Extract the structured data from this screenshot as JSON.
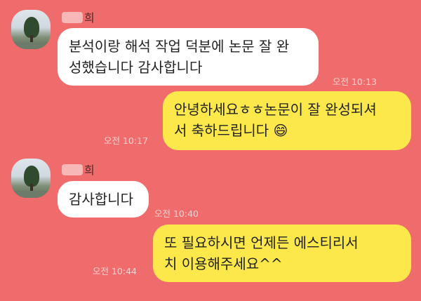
{
  "messages": [
    {
      "sender": "희",
      "text": "분석이랑 해석 작업 덕분에 논문 잘 완\n성했습니다 감사합니다",
      "time": "오전 10:13"
    },
    {
      "text": "안녕하세요ㅎㅎ논문이 잘 완성되셔\n서 축하드립니다 😄",
      "time": "오전 10:17"
    },
    {
      "sender": "희",
      "text": "감사합니다",
      "time": "오전 10:40"
    },
    {
      "text": "또 필요하시면 언제든 에스티리서\n치 이용해주세요^^",
      "time": "오전 10:44"
    }
  ],
  "colors": {
    "background": "#f06b6b",
    "incoming_bubble": "#ffffff",
    "outgoing_bubble": "#fde84c"
  },
  "icons": {
    "avatar": "profile-photo-icon"
  }
}
